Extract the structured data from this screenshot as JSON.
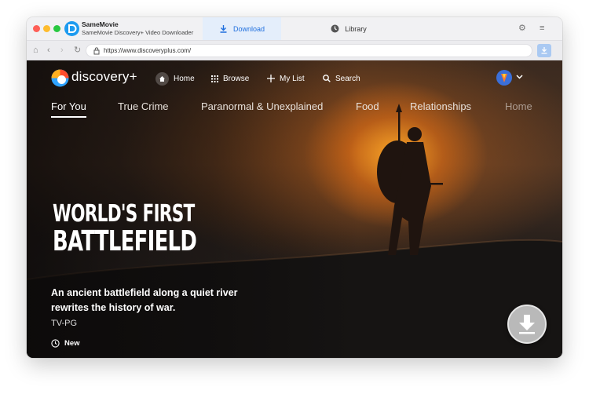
{
  "app": {
    "name": "SameMovie",
    "subtitle": "SameMovie Discovery+ Video Downloader"
  },
  "tabs": {
    "download": "Download",
    "library": "Library"
  },
  "browser": {
    "url": "https://www.discoveryplus.com/"
  },
  "site": {
    "brand": "discovery+",
    "nav": {
      "home": "Home",
      "browse": "Browse",
      "mylist": "My List",
      "search": "Search"
    },
    "categories": [
      "For You",
      "True Crime",
      "Paranormal & Unexplained",
      "Food",
      "Relationships",
      "Home"
    ],
    "active_category": "For You"
  },
  "hero": {
    "title_line1": "WORLD'S FIRST",
    "title_line2": "BATTLEFIELD",
    "description": "An ancient battlefield along a quiet river rewrites the history of war.",
    "rating": "TV-PG",
    "badge": "New"
  },
  "colors": {
    "accent": "#1f6fde",
    "tab_active_bg": "#e4eefb",
    "watch_button": "#2f6ff0"
  },
  "icons": {
    "titlebar": [
      "settings-icon",
      "menu-icon"
    ],
    "addressbar": [
      "home-icon",
      "back-icon",
      "forward-icon",
      "reload-icon",
      "lock-icon",
      "download-icon"
    ],
    "site": [
      "discovery-logo-icon",
      "home-icon",
      "grid-icon",
      "plus-icon",
      "search-icon",
      "chevron-down-icon",
      "clock-icon",
      "download-fab-icon"
    ]
  }
}
